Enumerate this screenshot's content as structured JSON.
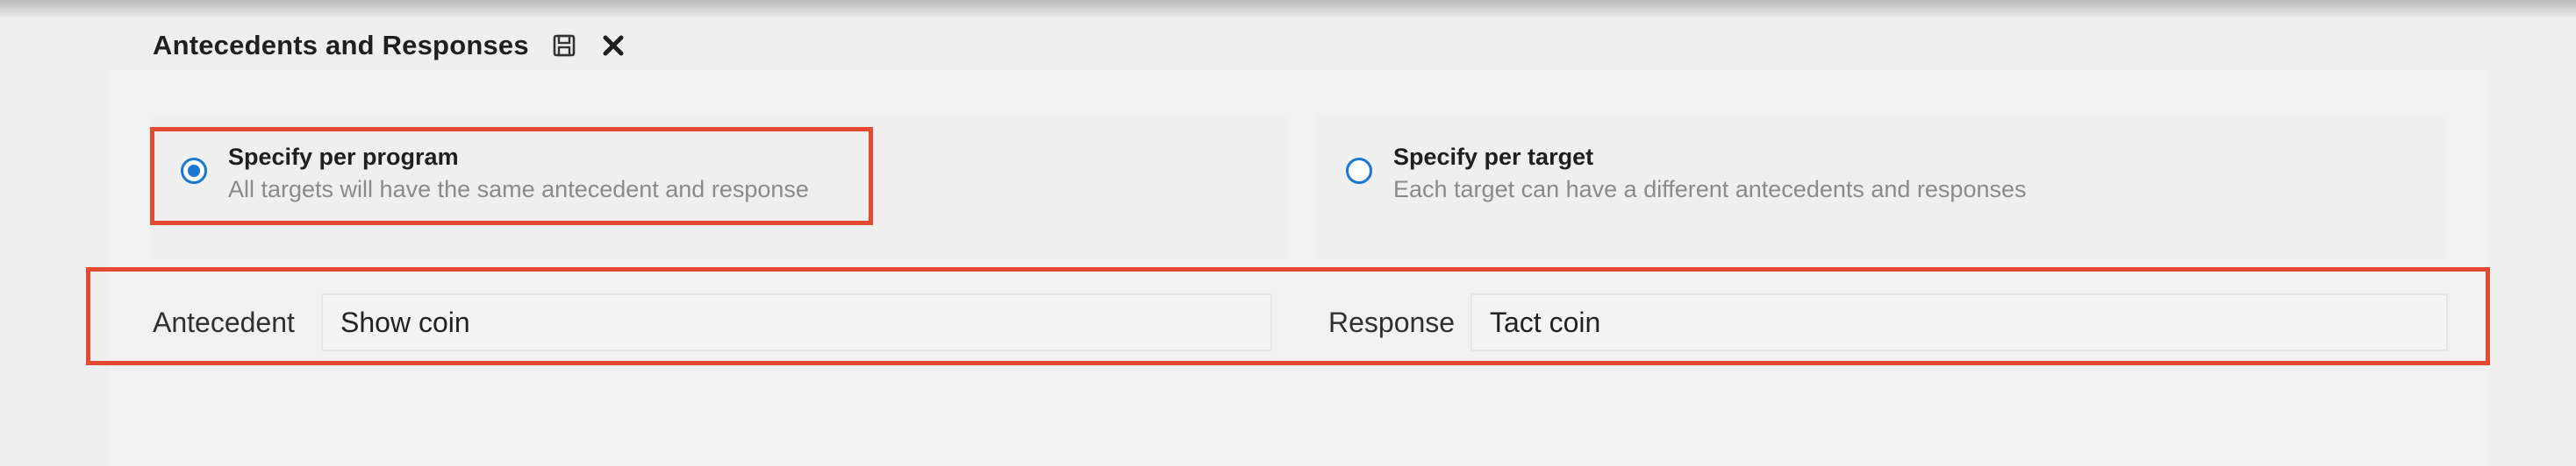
{
  "header": {
    "title": "Antecedents and Responses",
    "save_icon": "save-icon",
    "close_icon": "close-icon"
  },
  "options": {
    "per_program": {
      "title": "Specify per program",
      "description": "All targets will have the same antecedent and response",
      "selected": true
    },
    "per_target": {
      "title": "Specify per target",
      "description": "Each target can have a different antecedents and responses",
      "selected": false
    }
  },
  "fields": {
    "antecedent": {
      "label": "Antecedent",
      "value": "Show coin"
    },
    "response": {
      "label": "Response",
      "value": "Tact coin"
    }
  },
  "colors": {
    "accent": "#1976d2",
    "highlight": "#e34a2f",
    "background": "#efefef"
  }
}
